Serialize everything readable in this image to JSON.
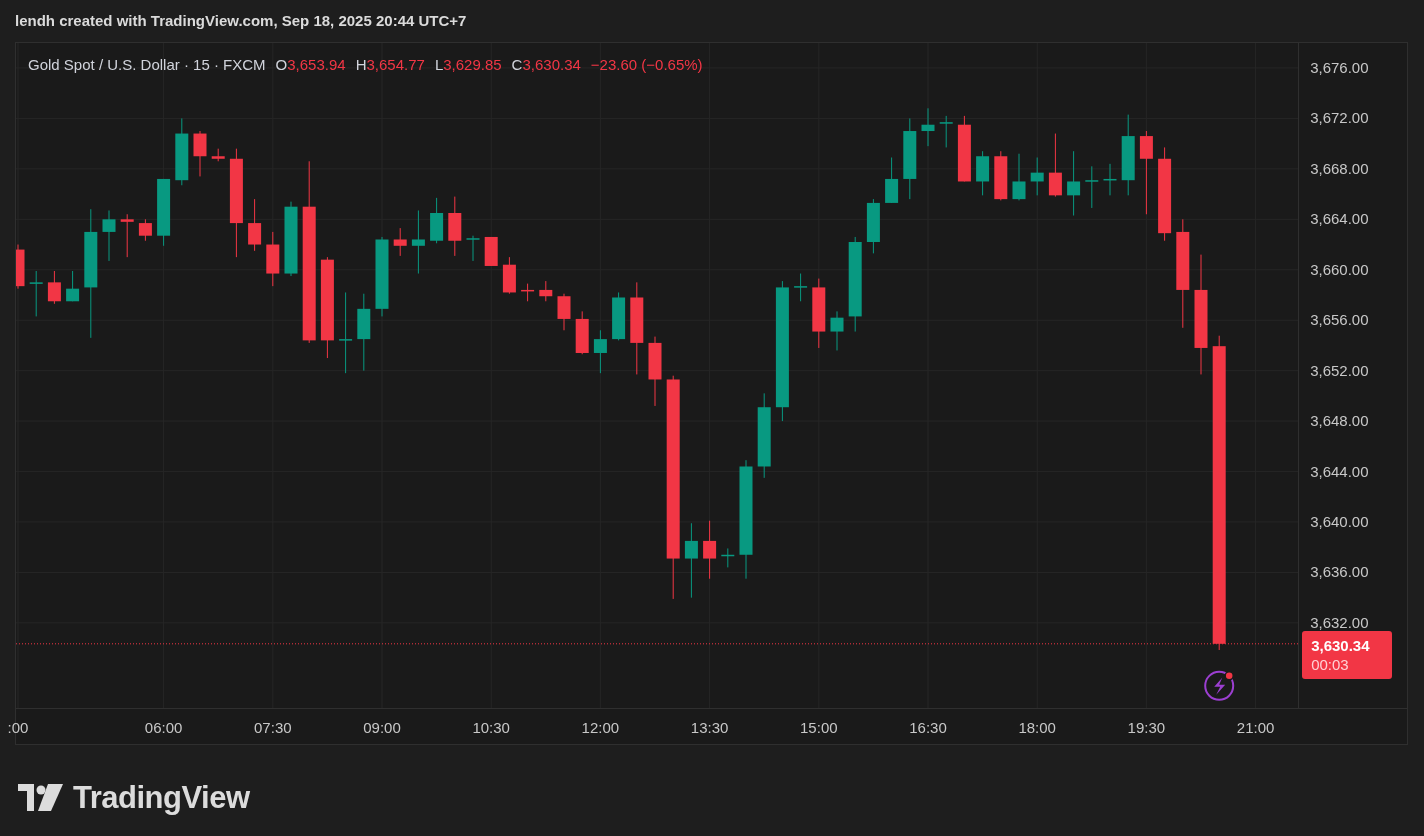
{
  "header": {
    "title": "lendh created with TradingView.com, Sep 18, 2025 20:44 UTC+7"
  },
  "legend": {
    "symbol": "Gold Spot / U.S. Dollar · 15 · FXCM",
    "fields": [
      {
        "label": "O",
        "value": "3,653.94"
      },
      {
        "label": "H",
        "value": "3,654.77"
      },
      {
        "label": "L",
        "value": "3,629.85"
      },
      {
        "label": "C",
        "value": "3,630.34"
      }
    ],
    "change": "−23.60 (−0.65%)"
  },
  "price_tag": {
    "price": "3,630.34",
    "countdown": "00:03"
  },
  "chart": {
    "chart_data": {
      "type": "candlestick",
      "grid": true,
      "ref_lines": [
        {
          "axis": "y",
          "value": 3630.34
        }
      ],
      "ylim": [
        3625.25,
        3677.98
      ],
      "yticks": [
        {
          "value": 3676,
          "label": "3,676.00"
        },
        {
          "value": 3672,
          "label": "3,672.00"
        },
        {
          "value": 3668,
          "label": "3,668.00"
        },
        {
          "value": 3664,
          "label": "3,664.00"
        },
        {
          "value": 3660,
          "label": "3,660.00"
        },
        {
          "value": 3656,
          "label": "3,656.00"
        },
        {
          "value": 3652,
          "label": "3,652.00"
        },
        {
          "value": 3648,
          "label": "3,648.00"
        },
        {
          "value": 3644,
          "label": "3,644.00"
        },
        {
          "value": 3640,
          "label": "3,640.00"
        },
        {
          "value": 3636,
          "label": "3,636.00"
        },
        {
          "value": 3632,
          "label": "3,632.00"
        }
      ],
      "categories": [
        ":00",
        null,
        null,
        null,
        null,
        null,
        null,
        null,
        "06:00",
        null,
        null,
        null,
        null,
        null,
        "07:30",
        null,
        null,
        null,
        null,
        null,
        "09:00",
        null,
        null,
        null,
        null,
        null,
        "10:30",
        null,
        null,
        null,
        null,
        null,
        "12:00",
        null,
        null,
        null,
        null,
        null,
        "13:30",
        null,
        null,
        null,
        null,
        null,
        "15:00",
        null,
        null,
        null,
        null,
        null,
        "16:30",
        null,
        null,
        null,
        null,
        null,
        "18:00",
        null,
        null,
        null,
        null,
        null,
        "19:30",
        null,
        null,
        null,
        null,
        null,
        "21:00"
      ],
      "ohlc": [
        [
          3661.6,
          3662,
          3658.5,
          3658.7
        ],
        [
          3658.9,
          3659.9,
          3656.3,
          3659
        ],
        [
          3659,
          3659.9,
          3657.3,
          3657.5
        ],
        [
          3657.5,
          3659.9,
          3657.5,
          3658.5
        ],
        [
          3658.6,
          3664.8,
          3654.6,
          3663
        ],
        [
          3663,
          3664.7,
          3660.7,
          3664
        ],
        [
          3664,
          3664.4,
          3661,
          3663.8
        ],
        [
          3663.7,
          3664,
          3662.3,
          3662.7
        ],
        [
          3662.7,
          3667.2,
          3661.9,
          3667.2
        ],
        [
          3667.1,
          3672,
          3666.7,
          3670.8
        ],
        [
          3670.8,
          3671,
          3667.4,
          3669
        ],
        [
          3669,
          3669.6,
          3668.6,
          3668.8
        ],
        [
          3668.8,
          3669.6,
          3661,
          3663.7
        ],
        [
          3663.7,
          3665.6,
          3661.5,
          3662
        ],
        [
          3662,
          3663,
          3658.7,
          3659.7
        ],
        [
          3659.7,
          3665.4,
          3659.5,
          3665
        ],
        [
          3665,
          3668.6,
          3654.2,
          3654.4
        ],
        [
          3660.8,
          3661,
          3653,
          3654.4
        ],
        [
          3654.4,
          3658.2,
          3651.8,
          3654.5
        ],
        [
          3654.5,
          3658.1,
          3652,
          3656.9
        ],
        [
          3656.9,
          3662.6,
          3656.3,
          3662.4
        ],
        [
          3662.4,
          3663.3,
          3661.1,
          3661.9
        ],
        [
          3661.9,
          3664.7,
          3659.7,
          3662.4
        ],
        [
          3662.3,
          3665.7,
          3662.1,
          3664.5
        ],
        [
          3664.5,
          3665.8,
          3661.1,
          3662.3
        ],
        [
          3662.4,
          3662.7,
          3660.7,
          3662.5
        ],
        [
          3662.6,
          3662.6,
          3660.3,
          3660.3
        ],
        [
          3660.4,
          3661,
          3658.1,
          3658.2
        ],
        [
          3658.4,
          3658.9,
          3657.5,
          3658.3
        ],
        [
          3658.4,
          3659.1,
          3657.5,
          3657.9
        ],
        [
          3657.9,
          3658.1,
          3655.2,
          3656.1
        ],
        [
          3656.1,
          3656.7,
          3653.3,
          3653.4
        ],
        [
          3653.4,
          3655.2,
          3651.8,
          3654.5
        ],
        [
          3654.5,
          3658.2,
          3654.4,
          3657.8
        ],
        [
          3657.8,
          3659,
          3651.7,
          3654.2
        ],
        [
          3654.2,
          3654.7,
          3649.2,
          3651.3
        ],
        [
          3651.3,
          3651.6,
          3633.9,
          3637.1
        ],
        [
          3637.1,
          3639.9,
          3634,
          3638.5
        ],
        [
          3638.5,
          3640.1,
          3635.5,
          3637.1
        ],
        [
          3637.3,
          3637.9,
          3636.4,
          3637.4
        ],
        [
          3637.4,
          3644.9,
          3635.5,
          3644.4
        ],
        [
          3644.4,
          3650.2,
          3643.5,
          3649.1
        ],
        [
          3649.1,
          3659.1,
          3648,
          3658.6
        ],
        [
          3658.6,
          3659.7,
          3657.5,
          3658.7
        ],
        [
          3658.6,
          3659.3,
          3653.8,
          3655.1
        ],
        [
          3655.1,
          3656.7,
          3653.6,
          3656.2
        ],
        [
          3656.3,
          3662.6,
          3655.1,
          3662.2
        ],
        [
          3662.2,
          3665.6,
          3661.3,
          3665.3
        ],
        [
          3665.3,
          3668.9,
          3665.3,
          3667.2
        ],
        [
          3667.2,
          3672,
          3665.6,
          3671
        ],
        [
          3671,
          3672.8,
          3669.8,
          3671.5
        ],
        [
          3671.6,
          3672.2,
          3669.7,
          3671.7
        ],
        [
          3671.5,
          3672.2,
          3667,
          3667
        ],
        [
          3667,
          3669.4,
          3665.9,
          3669
        ],
        [
          3669,
          3669.4,
          3665.5,
          3665.6
        ],
        [
          3665.6,
          3669.2,
          3665.5,
          3667
        ],
        [
          3667,
          3668.9,
          3665.9,
          3667.7
        ],
        [
          3667.7,
          3670.8,
          3665.8,
          3665.9
        ],
        [
          3665.9,
          3669.4,
          3664.3,
          3667
        ],
        [
          3667,
          3668.2,
          3664.9,
          3667.1
        ],
        [
          3667.1,
          3668.4,
          3665.9,
          3667.2
        ],
        [
          3667.1,
          3672.3,
          3665.9,
          3670.6
        ],
        [
          3670.6,
          3671,
          3664.4,
          3668.8
        ],
        [
          3668.8,
          3669.7,
          3662.3,
          3662.9
        ],
        [
          3663,
          3664,
          3655.4,
          3658.4
        ],
        [
          3658.4,
          3661.2,
          3651.7,
          3653.8
        ],
        [
          3653.94,
          3654.77,
          3629.85,
          3630.34
        ],
        null,
        null
      ]
    }
  },
  "footer": {
    "brand": "TradingView"
  }
}
